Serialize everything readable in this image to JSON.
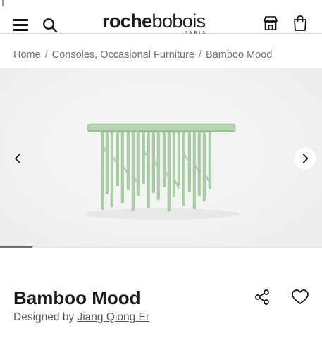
{
  "header": {
    "logo": {
      "bold": "roche",
      "light": "bobois",
      "sub": "PARIS"
    },
    "icons": {
      "menu": "hamburger-menu-icon",
      "search": "search-icon",
      "store": "store-icon",
      "bag": "shopping-bag-icon"
    }
  },
  "breadcrumb": {
    "items": [
      "Home",
      "Consoles, Occasional Furniture",
      "Bamboo Mood"
    ],
    "separator": "/"
  },
  "gallery": {
    "prev_icon": "chevron-left-icon",
    "next_icon": "chevron-right-icon",
    "product_color": "#a9cfa4",
    "progress": 0.1
  },
  "product": {
    "title": "Bamboo Mood",
    "designed_by_prefix": "Designed by",
    "designer": "Jiang Qiong Er",
    "share_icon": "share-icon",
    "favorite_icon": "heart-icon"
  }
}
